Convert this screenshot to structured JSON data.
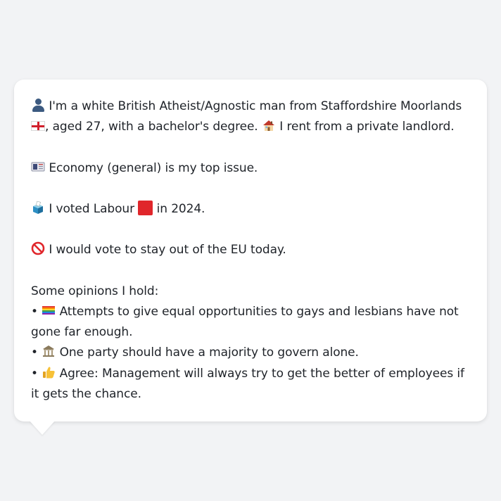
{
  "profile": {
    "line1_part1": "I'm a white British Atheist/Agnostic man from Staffordshire Moorlands",
    "line1_part2": ", aged 27, with a bachelor's degree.",
    "line1_part3": "I rent from a private landlord.",
    "issue": "Economy (general) is my top issue.",
    "vote_part1": "I voted Labour",
    "vote_part2": "in 2024.",
    "eu": "I would vote to stay out of the EU today.",
    "opinions_heading": "Some opinions I hold:",
    "opinions": [
      "Attempts to give equal opportunities to gays and lesbians have not gone far enough.",
      "One party should have a majority to govern alone.",
      "Agree: Management will always try to get the better of employees if it gets the chance."
    ],
    "bullet": "•"
  },
  "icons": {
    "person": "bust-in-silhouette-icon",
    "england_flag": "england-flag-icon",
    "house": "house-icon",
    "newspaper": "newspaper-icon",
    "ballot": "ballot-box-icon",
    "red_square": "red-square-icon",
    "prohibited": "prohibited-icon",
    "rainbow_flag": "rainbow-flag-icon",
    "classical_building": "classical-building-icon",
    "thumbs_up": "thumbs-up-icon"
  },
  "colors": {
    "background": "#f2f3f5",
    "bubble": "#ffffff",
    "text": "#1f2329",
    "labour_red": "#e0262b"
  }
}
